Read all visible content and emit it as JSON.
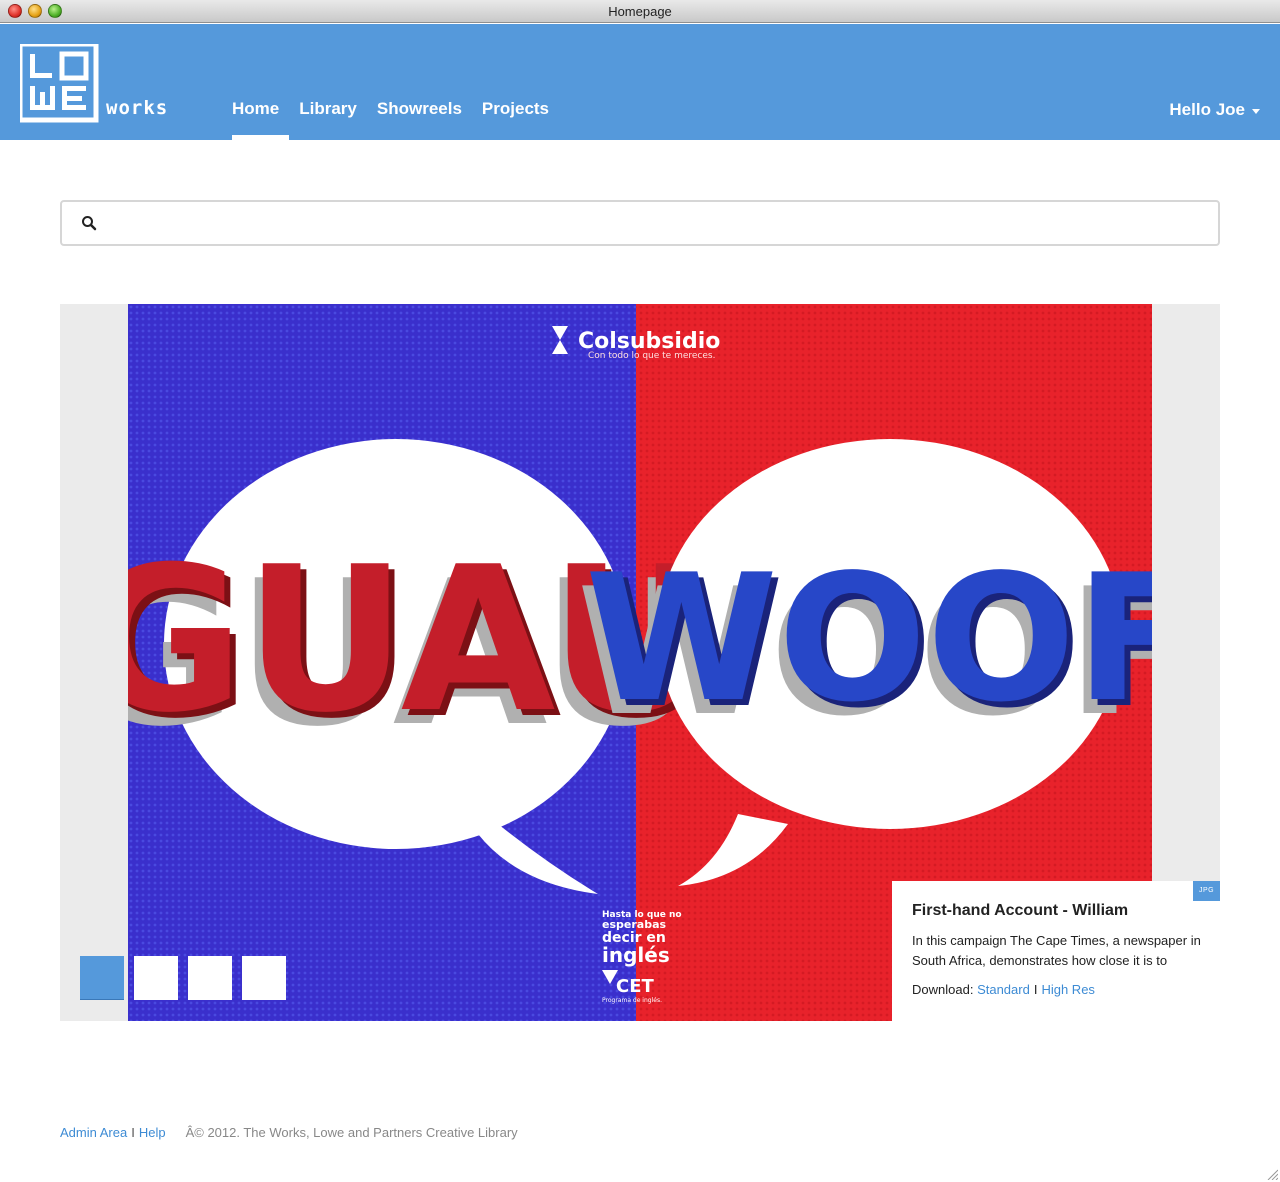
{
  "window": {
    "title": "Homepage"
  },
  "brand": {
    "logo_text": "LOWE",
    "logo_subtext": "works",
    "brand_color": "#5599db"
  },
  "nav": {
    "items": [
      {
        "label": "Home",
        "active": true
      },
      {
        "label": "Library",
        "active": false
      },
      {
        "label": "Showreels",
        "active": false
      },
      {
        "label": "Projects",
        "active": false
      }
    ],
    "user_label": "Hello Joe"
  },
  "search": {
    "placeholder": "",
    "value": "",
    "icon": "search-icon"
  },
  "carousel": {
    "slide": {
      "brand_name": "Colsubsidio",
      "brand_tagline": "Con todo lo que te mereces.",
      "left_word": "GUAU",
      "right_word": "WOOF",
      "bottom_tagline": [
        "Hasta lo que no",
        "esperabas",
        "decir en",
        "inglés"
      ],
      "bottom_logo": "CET",
      "bottom_logo_sub": "Programa de inglés.",
      "left_color": "#3b2fc9",
      "right_color": "#e8222b"
    },
    "thumbs": [
      {
        "active": true
      },
      {
        "active": false
      },
      {
        "active": false
      },
      {
        "active": false
      }
    ],
    "caption": {
      "file_type": "JPG",
      "title": "First-hand Account - William",
      "text": "In this campaign The Cape Times, a newspaper in South Africa, demonstrates how close it is to",
      "download_label": "Download:",
      "standard_label": "Standard",
      "separator": "I",
      "highres_label": "High Res"
    }
  },
  "footer": {
    "admin_label": "Admin Area",
    "separator": "I",
    "help_label": "Help",
    "copyright": "Â© 2012. The Works, Lowe and Partners Creative Library"
  }
}
